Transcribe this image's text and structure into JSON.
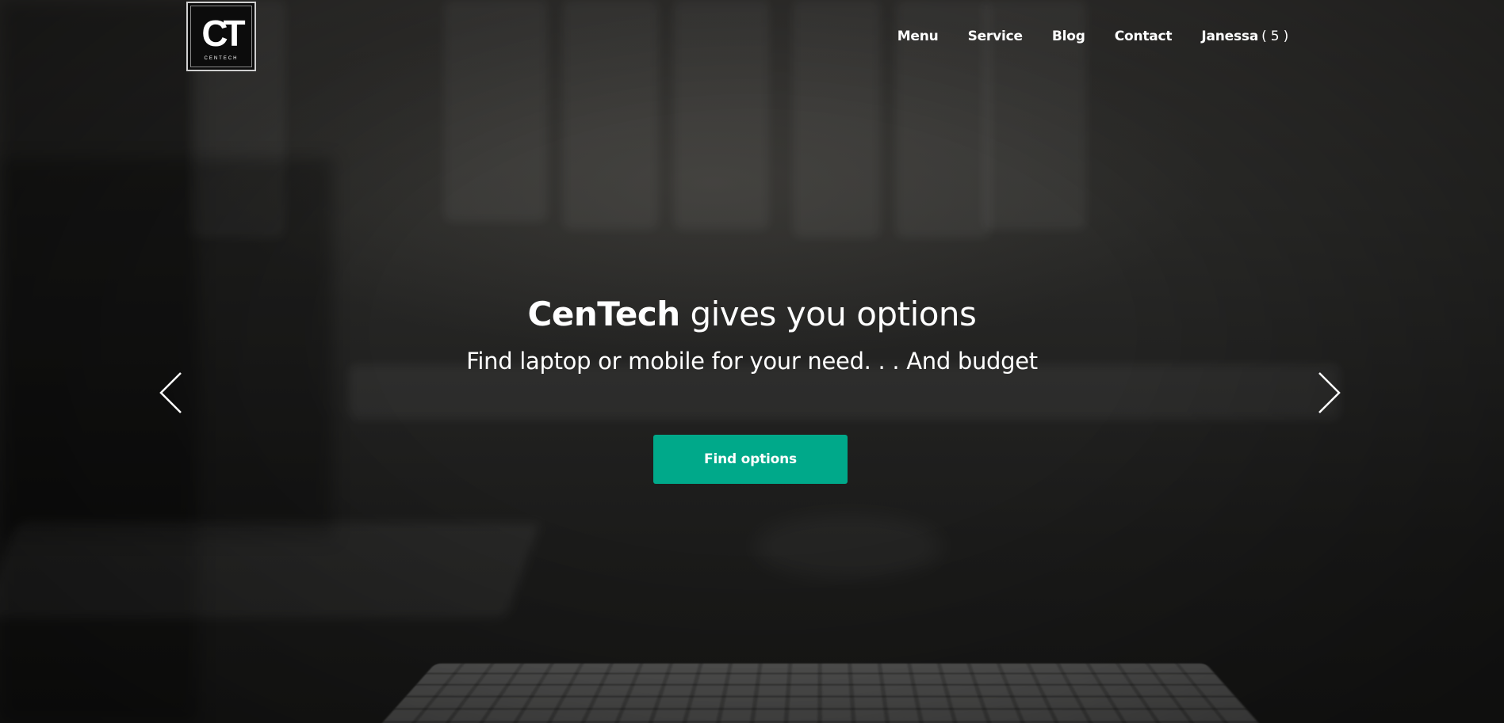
{
  "logo": {
    "mark": "CT",
    "text": "CENTECH"
  },
  "nav": {
    "items": [
      {
        "label": "Menu"
      },
      {
        "label": "Service"
      },
      {
        "label": "Blog"
      },
      {
        "label": "Contact"
      }
    ],
    "user": {
      "name": "Janessa",
      "count": "( 5 )"
    }
  },
  "hero": {
    "headline_brand": "CenTech",
    "headline_rest": " gives you options",
    "subline": "Find laptop or mobile for your need. . . And budget",
    "cta_label": "Find options"
  },
  "carousel": {
    "prev_icon": "chevron-left-icon",
    "next_icon": "chevron-right-icon"
  },
  "colors": {
    "accent": "#00a98a",
    "text": "#ffffff"
  }
}
